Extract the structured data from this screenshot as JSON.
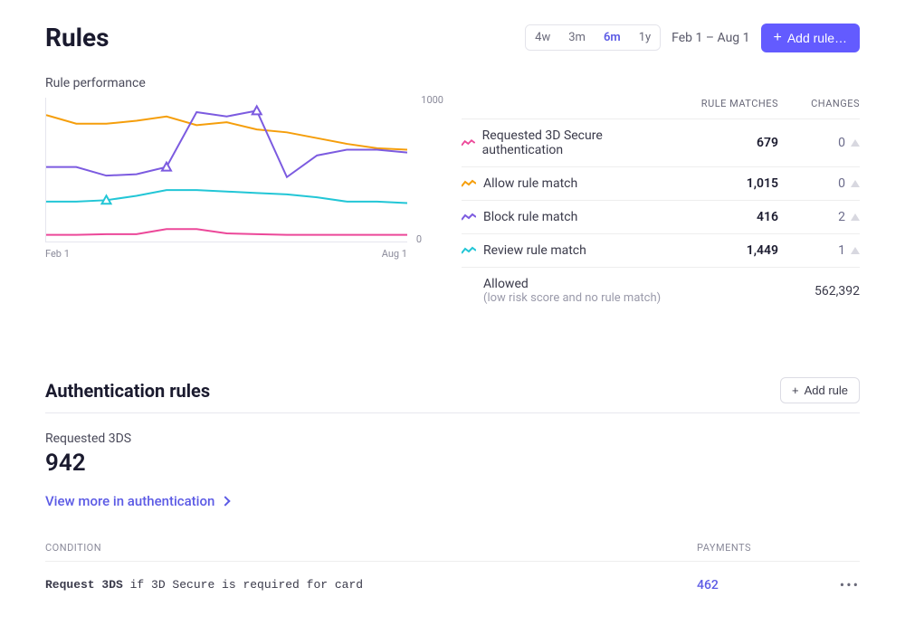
{
  "header": {
    "title": "Rules",
    "date_range": "Feb 1 – Aug 1",
    "add_rule_label": "Add rule…",
    "ranges": [
      "4w",
      "3m",
      "6m",
      "1y"
    ],
    "active_range": "6m"
  },
  "performance": {
    "section_title": "Rule performance",
    "y_max": "1000",
    "y_min": "0",
    "x_start": "Feb 1",
    "x_end": "Aug 1"
  },
  "chart_data": {
    "type": "line",
    "xlabel": "",
    "ylabel": "",
    "ylim": [
      0,
      1000
    ],
    "x": [
      "Feb 1",
      "Feb 15",
      "Mar 1",
      "Mar 15",
      "Apr 1",
      "Apr 15",
      "May 1",
      "May 15",
      "Jun 1",
      "Jun 15",
      "Jul 1",
      "Jul 15",
      "Aug 1"
    ],
    "series": [
      {
        "name": "Requested 3D Secure authentication",
        "color": "#ec4899",
        "values": [
          50,
          50,
          55,
          55,
          90,
          90,
          60,
          55,
          50,
          50,
          50,
          50,
          50
        ]
      },
      {
        "name": "Allow rule match",
        "color": "#f59e0b",
        "values": [
          880,
          820,
          820,
          840,
          870,
          810,
          830,
          780,
          760,
          720,
          680,
          650,
          640
        ]
      },
      {
        "name": "Block rule match",
        "color": "#7c5be0",
        "values": [
          520,
          520,
          460,
          470,
          520,
          900,
          870,
          910,
          450,
          600,
          640,
          640,
          620
        ]
      },
      {
        "name": "Review rule match",
        "color": "#22c6d6",
        "values": [
          280,
          280,
          290,
          320,
          360,
          360,
          350,
          340,
          330,
          310,
          280,
          280,
          270
        ]
      }
    ],
    "markers": [
      {
        "series": "Review rule match",
        "x_index": 2,
        "shape": "triangle"
      },
      {
        "series": "Block rule match",
        "x_index": 4,
        "shape": "triangle"
      },
      {
        "series": "Block rule match",
        "x_index": 7,
        "shape": "triangle"
      }
    ]
  },
  "table": {
    "headers": {
      "matches": "RULE MATCHES",
      "changes": "CHANGES"
    },
    "rows": [
      {
        "label": "Requested 3D Secure authentication",
        "matches": "679",
        "changes": "0",
        "color": "#ec4899"
      },
      {
        "label": "Allow rule match",
        "matches": "1,015",
        "changes": "0",
        "color": "#f59e0b"
      },
      {
        "label": "Block rule match",
        "matches": "416",
        "changes": "2",
        "color": "#7c5be0"
      },
      {
        "label": "Review rule match",
        "matches": "1,449",
        "changes": "1",
        "color": "#22c6d6"
      }
    ],
    "allowed": {
      "title": "Allowed",
      "sub": "(low risk score and no rule match)",
      "value": "562,392"
    }
  },
  "auth": {
    "title": "Authentication rules",
    "add_label": "Add rule",
    "stat_label": "Requested 3DS",
    "stat_value": "942",
    "viewmore": "View more in authentication",
    "cond_header": "CONDITION",
    "pay_header": "PAYMENTS",
    "rule_prefix": "Request 3DS ",
    "rule_cond": "if 3D Secure is required for card",
    "rule_payments": "462"
  }
}
